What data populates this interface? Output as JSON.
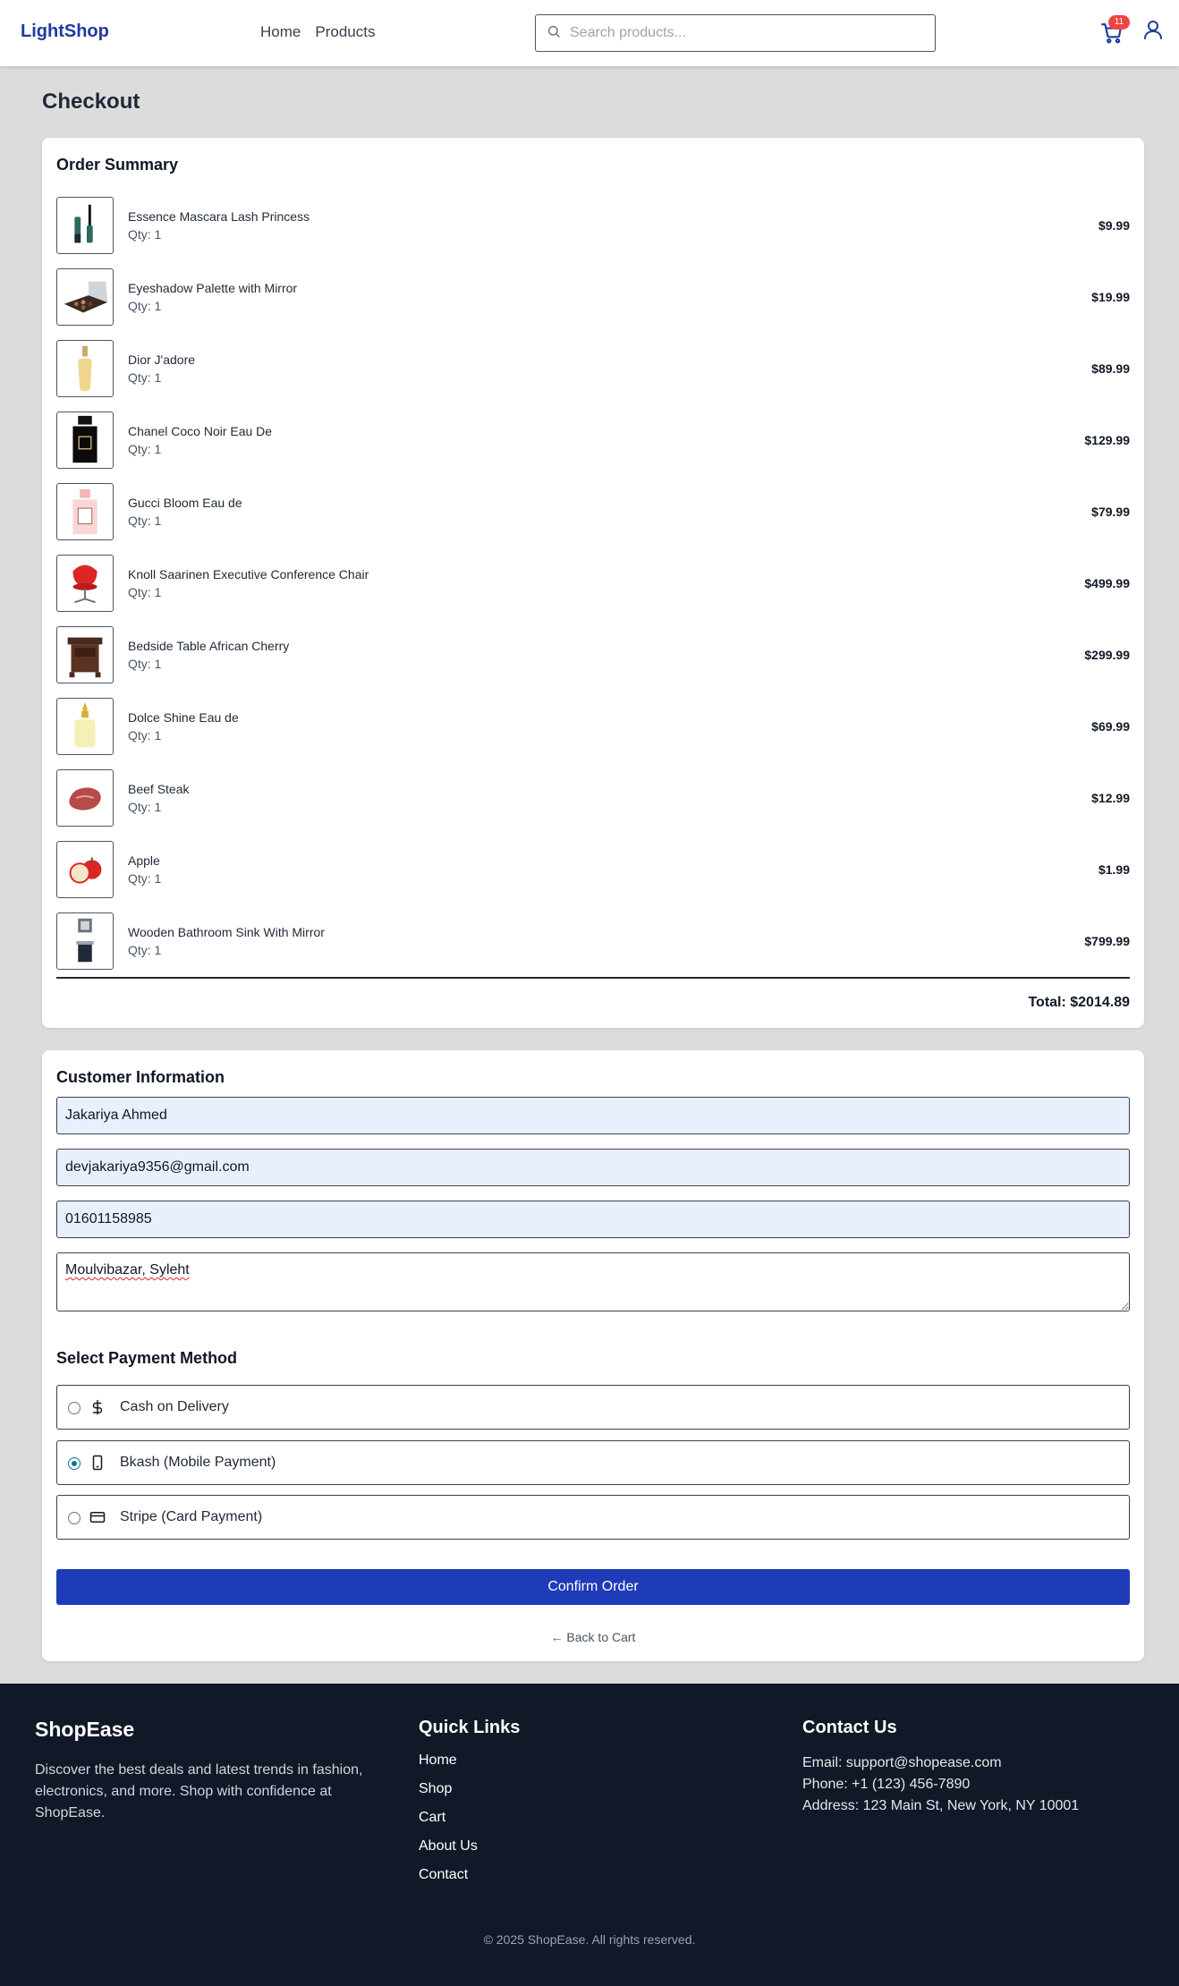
{
  "header": {
    "logo": "LightShop",
    "nav": [
      "Home",
      "Products"
    ],
    "search_placeholder": "Search products...",
    "cart_count": "11"
  },
  "page_title": "Checkout",
  "order_summary": {
    "title": "Order Summary",
    "items": [
      {
        "name": "Essence Mascara Lash Princess",
        "qty": "Qty: 1",
        "price": "$9.99",
        "icon": "mascara-icon"
      },
      {
        "name": "Eyeshadow Palette with Mirror",
        "qty": "Qty: 1",
        "price": "$19.99",
        "icon": "eyeshadow-palette-icon"
      },
      {
        "name": "Dior J'adore",
        "qty": "Qty: 1",
        "price": "$89.99",
        "icon": "perfume-bottle-icon"
      },
      {
        "name": "Chanel Coco Noir Eau De",
        "qty": "Qty: 1",
        "price": "$129.99",
        "icon": "perfume-bottle-icon"
      },
      {
        "name": "Gucci Bloom Eau de",
        "qty": "Qty: 1",
        "price": "$79.99",
        "icon": "perfume-bottle-icon"
      },
      {
        "name": "Knoll Saarinen Executive Conference Chair",
        "qty": "Qty: 1",
        "price": "$499.99",
        "icon": "chair-icon"
      },
      {
        "name": "Bedside Table African Cherry",
        "qty": "Qty: 1",
        "price": "$299.99",
        "icon": "bedside-table-icon"
      },
      {
        "name": "Dolce Shine Eau de",
        "qty": "Qty: 1",
        "price": "$69.99",
        "icon": "perfume-bottle-icon"
      },
      {
        "name": "Beef Steak",
        "qty": "Qty: 1",
        "price": "$12.99",
        "icon": "steak-icon"
      },
      {
        "name": "Apple",
        "qty": "Qty: 1",
        "price": "$1.99",
        "icon": "apple-icon"
      },
      {
        "name": "Wooden Bathroom Sink With Mirror",
        "qty": "Qty: 1",
        "price": "$799.99",
        "icon": "bathroom-sink-icon"
      }
    ],
    "total": "Total: $2014.89"
  },
  "customer": {
    "title": "Customer Information",
    "name": "Jakariya Ahmed",
    "email": "devjakariya9356@gmail.com",
    "phone": "01601158985",
    "address": "Moulvibazar, Syleht"
  },
  "payment": {
    "title": "Select Payment Method",
    "options": [
      {
        "label": "Cash on Delivery",
        "icon": "dollar-icon",
        "selected": false
      },
      {
        "label": "Bkash (Mobile Payment)",
        "icon": "smartphone-icon",
        "selected": true
      },
      {
        "label": "Stripe (Card Payment)",
        "icon": "credit-card-icon",
        "selected": false
      }
    ]
  },
  "confirm_label": "Confirm Order",
  "back_label": "← Back to Cart",
  "footer": {
    "brand": "ShopEase",
    "description": "Discover the best deals and latest trends in fashion, electronics, and more. Shop with confidence at ShopEase.",
    "quick_links_title": "Quick Links",
    "quick_links": [
      "Home",
      "Shop",
      "Cart",
      "About Us",
      "Contact"
    ],
    "contact_title": "Contact Us",
    "email": "Email: support@shopease.com",
    "phone": "Phone: +1 (123) 456-7890",
    "address": "Address: 123 Main St, New York, NY 10001",
    "copyright": "© 2025 ShopEase. All rights reserved."
  },
  "colors": {
    "brand": "#1e3a9e",
    "primary_button": "#1e3bb8",
    "badge": "#ef4444",
    "footer_bg": "#111827",
    "page_bg": "#dcdcdc",
    "autofill_bg": "#e8f0fe"
  }
}
